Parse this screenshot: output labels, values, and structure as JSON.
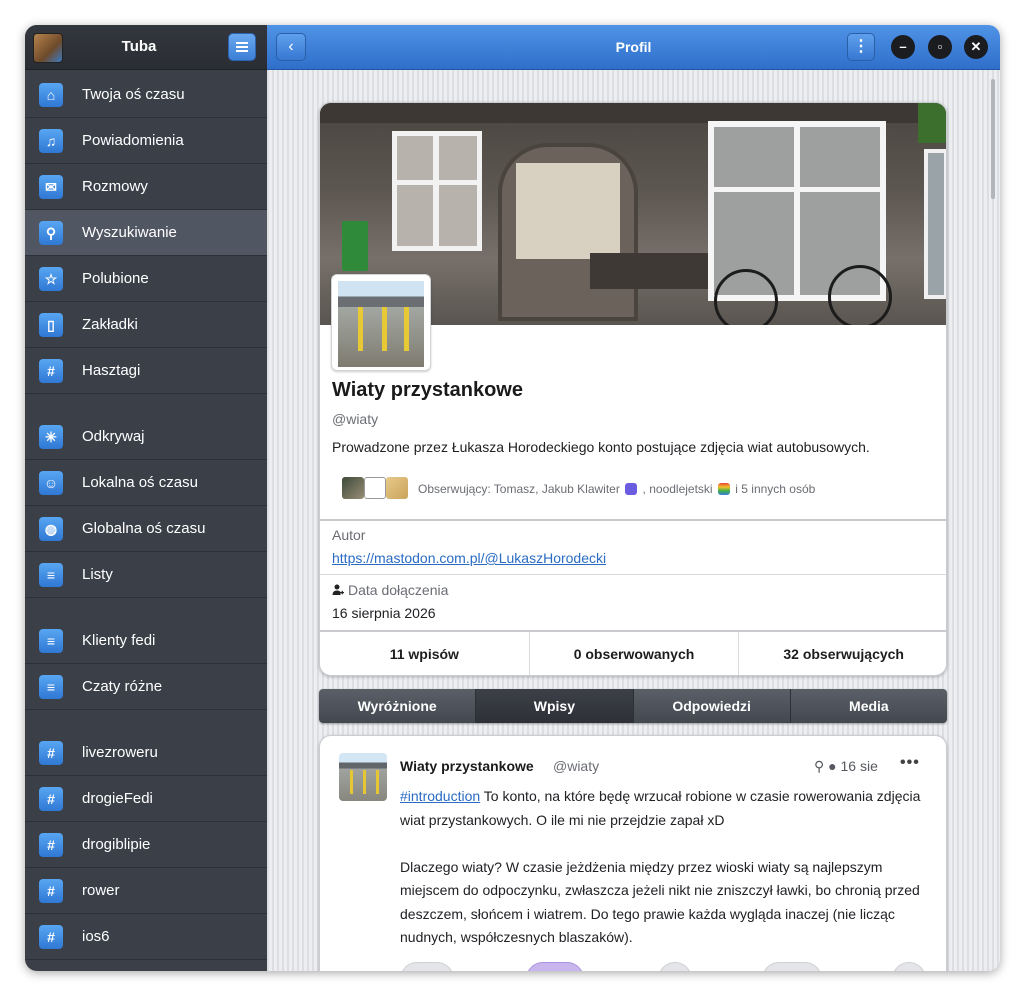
{
  "sidebar": {
    "title": "Tuba",
    "items": [
      {
        "label": "Twoja oś czasu",
        "icon": "home-icon",
        "glyph": "⌂"
      },
      {
        "label": "Powiadomienia",
        "icon": "bell-icon",
        "glyph": "♫"
      },
      {
        "label": "Rozmowy",
        "icon": "mail-icon",
        "glyph": "✉"
      },
      {
        "label": "Wyszukiwanie",
        "icon": "search-icon",
        "glyph": "⚲"
      },
      {
        "label": "Polubione",
        "icon": "star-icon",
        "glyph": "☆"
      },
      {
        "label": "Zakładki",
        "icon": "bookmark-icon",
        "glyph": "▯"
      },
      {
        "label": "Hasztagi",
        "icon": "hashtag-icon",
        "glyph": "#"
      },
      {
        "label": "Odkrywaj",
        "icon": "explore-icon",
        "glyph": "✳"
      },
      {
        "label": "Lokalna oś czasu",
        "icon": "local-timeline-icon",
        "glyph": "☺"
      },
      {
        "label": "Globalna oś czasu",
        "icon": "globe-icon",
        "glyph": "◍"
      },
      {
        "label": "Listy",
        "icon": "list-icon",
        "glyph": "≡"
      },
      {
        "label": "Klienty fedi",
        "icon": "list-icon",
        "glyph": "≡"
      },
      {
        "label": "Czaty różne",
        "icon": "list-icon",
        "glyph": "≡"
      },
      {
        "label": "livezroweru",
        "icon": "hashtag-icon",
        "glyph": "#"
      },
      {
        "label": "drogieFedi",
        "icon": "hashtag-icon",
        "glyph": "#"
      },
      {
        "label": "drogiblipie",
        "icon": "hashtag-icon",
        "glyph": "#"
      },
      {
        "label": "rower",
        "icon": "hashtag-icon",
        "glyph": "#"
      },
      {
        "label": "ios6",
        "icon": "hashtag-icon",
        "glyph": "#"
      }
    ]
  },
  "header": {
    "title": "Profil"
  },
  "profile": {
    "name": "Wiaty przystankowe",
    "handle": "@wiaty",
    "bio": "Prowadzone przez Łukasza Horodeckiego konto postujące zdjęcia wiat autobusowych.",
    "followers_prefix": "Obserwujący: Tomasz, Jakub Klawiter",
    "followers_mid": ", noodlejetski",
    "followers_suffix": " i 5 innych osób",
    "fields": [
      {
        "label": "Autor",
        "value": "https://mastodon.com.pl/@LukaszHorodecki"
      }
    ],
    "joined_label": "Data dołączenia",
    "joined_value": "16 sierpnia 2026",
    "stats": {
      "posts": "11 wpisów",
      "following": "0 obserwowanych",
      "followers": "32 obserwujących"
    }
  },
  "tabs": [
    "Wyróżnione",
    "Wpisy",
    "Odpowiedzi",
    "Media"
  ],
  "active_tab": "Wpisy",
  "post": {
    "author": "Wiaty przystankowe",
    "handle": "@wiaty",
    "time": "16 sie",
    "hashtag": "#introduction",
    "text1": " To konto, na które będę wrzucał robione w czasie rowerowania zdjęcia wiat przystankowych. O ile mi nie przejdzie zapał xD",
    "text2": "Dlaczego wiaty? W czasie jeżdżenia między przez wioski wiaty są najlepszym miejscem do odpoczynku, zwłaszcza jeżeli nikt nie zniszczył ławki, bo chronią przed deszczem, słońcem i wiatrem. Do tego prawie każda wygląda inaczej (nie licząc nudnych, współczesnych blaszaków)."
  },
  "colors": {
    "accent": "#3b7fd6",
    "sidebar_bg": "#3a3f48",
    "link": "#2a6cc4"
  }
}
